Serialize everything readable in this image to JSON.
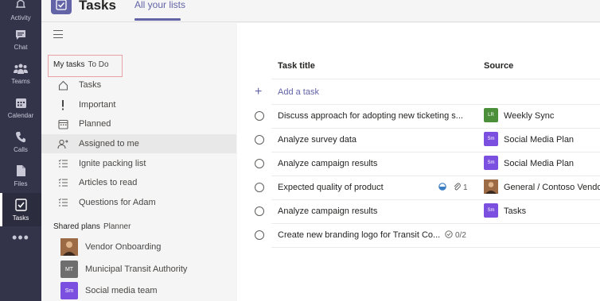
{
  "rail": {
    "items": [
      {
        "label": "Activity",
        "icon": "bell-icon"
      },
      {
        "label": "Chat",
        "icon": "chat-icon"
      },
      {
        "label": "Teams",
        "icon": "teams-icon"
      },
      {
        "label": "Calendar",
        "icon": "calendar-icon"
      },
      {
        "label": "Calls",
        "icon": "phone-icon"
      },
      {
        "label": "Files",
        "icon": "file-icon"
      },
      {
        "label": "Tasks",
        "icon": "tasks-icon",
        "active": true
      }
    ],
    "more": "•••"
  },
  "header": {
    "title": "Tasks",
    "tab": "All your lists"
  },
  "sidebar": {
    "my_tasks": {
      "title": "My tasks",
      "subtitle": "To Do"
    },
    "lists": [
      {
        "label": "Tasks",
        "icon": "home-icon"
      },
      {
        "label": "Important",
        "icon": "exclamation-icon"
      },
      {
        "label": "Planned",
        "icon": "calendar-icon"
      },
      {
        "label": "Assigned to me",
        "icon": "person-assigned-icon",
        "selected": true
      },
      {
        "label": "Ignite packing list",
        "icon": "list-icon"
      },
      {
        "label": "Articles to read",
        "icon": "list-icon"
      },
      {
        "label": "Questions for Adam",
        "icon": "list-icon"
      }
    ],
    "shared_plans": {
      "title": "Shared plans",
      "subtitle": "Planner"
    },
    "plans": [
      {
        "label": "Vendor Onboarding",
        "avatar": "",
        "color": "#8a5a3c"
      },
      {
        "label": "Municipal Transit Authority",
        "avatar": "MT",
        "color": "#6e6e6e"
      },
      {
        "label": "Social media team",
        "avatar": "Sm",
        "color": "#7b4fe0"
      }
    ]
  },
  "main": {
    "columns": {
      "title": "Task title",
      "source": "Source"
    },
    "add_task": "Add a task",
    "tasks": [
      {
        "title": "Discuss approach for adopting new ticketing s...",
        "source": "Weekly Sync",
        "source_avatar": "LR",
        "source_color": "#4c8f3a",
        "meta": ""
      },
      {
        "title": "Analyze survey data",
        "source": "Social Media Plan",
        "source_avatar": "Sm",
        "source_color": "#7b4fe0",
        "meta": ""
      },
      {
        "title": "Analyze campaign results",
        "source": "Social Media Plan",
        "source_avatar": "Sm",
        "source_color": "#7b4fe0",
        "meta": ""
      },
      {
        "title": "Expected quality of product",
        "source": "General / Contoso Vendo",
        "source_avatar": "",
        "source_color": "#8a5a3c",
        "meta": "1",
        "meta_icons": [
          "progress-icon",
          "attachment-icon"
        ]
      },
      {
        "title": "Analyze campaign results",
        "source": "Tasks",
        "source_avatar": "Sm",
        "source_color": "#7b4fe0",
        "meta": ""
      },
      {
        "title": "Create new branding logo for Transit Co...",
        "source": "",
        "source_avatar": "",
        "source_color": "",
        "meta": "0/2",
        "meta_icons": [
          "checklist-icon"
        ]
      }
    ]
  }
}
